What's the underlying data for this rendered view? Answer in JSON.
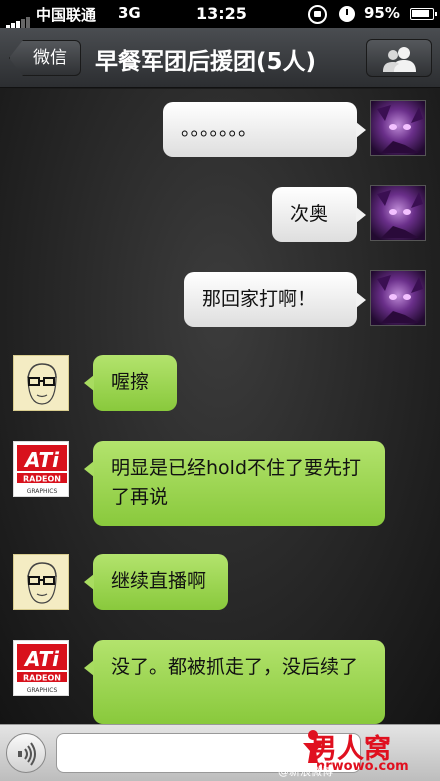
{
  "status_bar": {
    "carrier": "中国联通",
    "network": "3G",
    "time": "13:25",
    "battery": "95%",
    "icons": [
      "signal-icon",
      "rotation-lock-icon",
      "alarm-icon",
      "battery-icon"
    ]
  },
  "nav": {
    "back_label": "微信",
    "title": "早餐军团后援团(5人)",
    "members_icon": "contacts-icon"
  },
  "messages": [
    {
      "side": "out",
      "avatar": "purple-avatar",
      "text": "。。。。。。。"
    },
    {
      "side": "out",
      "avatar": "purple-avatar",
      "text": "次奥"
    },
    {
      "side": "out",
      "avatar": "purple-avatar",
      "text": "那回家打啊！"
    },
    {
      "side": "in",
      "avatar": "sketch-avatar",
      "text": "喔擦"
    },
    {
      "side": "in",
      "avatar": "ati-avatar",
      "text": "明显是已经hold不住了要先打了再说"
    },
    {
      "side": "in",
      "avatar": "sketch-avatar",
      "text": "继续直播啊"
    },
    {
      "side": "in",
      "avatar": "ati-avatar",
      "text": "没了。都被抓走了，没后续了"
    }
  ],
  "avatars": {
    "ati_logo": "ATi",
    "ati_sub": "RADEON",
    "ati_tagline": "GRAPHICS"
  },
  "input": {
    "voice_icon": "voice-icon",
    "placeholder": ""
  },
  "watermark": {
    "logo_text": "男人窝",
    "logo_url": "nrwowo.com",
    "weibo_text": "@新浪微博"
  },
  "colors": {
    "incoming_bubble": "#9fd455",
    "outgoing_bubble": "#f1f1f1",
    "nav_bar": "#3a3d41",
    "watermark": "#e0101f"
  }
}
